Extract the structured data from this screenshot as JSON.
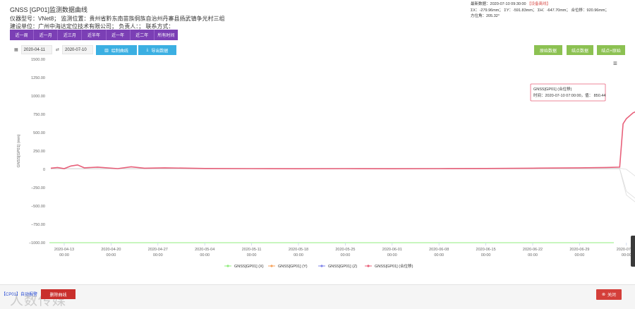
{
  "header": {
    "title": "GNSS [GP01]监测数据曲线",
    "device_line": "仪器型号：VNet8；  监测位置：贵州省黔东南苗族侗族自治州丹寨县扬武镇争光村三组",
    "unit_line": "建设单位：广州中海达定位技术有限公司；  负责人：；  联系方式："
  },
  "latest": {
    "prefix": "最新数据：",
    "time": "2020-07-10 09:30:00",
    "flag": "【设备离线】",
    "xyz": "ΣX：-279.96mm；  ΣY：-591.83mm；  ΣH：-647.70mm；  合位移：920.96mm；",
    "azimuth": "方位角：205.32°"
  },
  "ranges": [
    "近一周",
    "近一月",
    "近三月",
    "近半年",
    "近一年",
    "近二年",
    "所有时间"
  ],
  "dates": {
    "start": "2020-04-11",
    "end": "2020-07-10"
  },
  "toolbar": {
    "draw_label": "绘制曲线",
    "export_label": "导出数据",
    "btn_a": "原始数据",
    "btn_b": "结点数据",
    "btn_c": "结点+原始"
  },
  "icons": {
    "calendar": "calendar-icon",
    "chart": "bar-chart-icon",
    "download": "download-icon",
    "menu": "hamburger-menu-icon",
    "close": "close-circle-icon"
  },
  "chart_data": {
    "type": "line",
    "title": "",
    "ylabel": "GNSS[GP01] (mm)",
    "ylim": [
      -1000,
      1500
    ],
    "yticks": [
      "1500.00",
      "1250.00",
      "1000.00",
      "750.00",
      "500.00",
      "250.00",
      "0",
      "−250.00",
      "−500.00",
      "−750.00",
      "−1000.00"
    ],
    "xticks": [
      {
        "date": "2020-04-13",
        "time": "00:00"
      },
      {
        "date": "2020-04-20",
        "time": "00:00"
      },
      {
        "date": "2020-04-27",
        "time": "00:00"
      },
      {
        "date": "2020-05-04",
        "time": "00:00"
      },
      {
        "date": "2020-05-11",
        "time": "00:00"
      },
      {
        "date": "2020-05-18",
        "time": "00:00"
      },
      {
        "date": "2020-05-25",
        "time": "00:00"
      },
      {
        "date": "2020-06-01",
        "time": "00:00"
      },
      {
        "date": "2020-06-08",
        "time": "00:00"
      },
      {
        "date": "2020-06-15",
        "time": "00:00"
      },
      {
        "date": "2020-06-22",
        "time": "00:00"
      },
      {
        "date": "2020-06-29",
        "time": "00:00"
      },
      {
        "date": "2020-07-06",
        "time": "00:00"
      },
      {
        "date": "2020-07",
        "time": "00:00"
      }
    ],
    "xrange": [
      "2020-04-11",
      "2020-07-10"
    ],
    "series": [
      {
        "name": "GNSS[GP01] (X)",
        "color": "#90ed7d",
        "points": [
          [
            "2020-04-11",
            10
          ],
          [
            "2020-07-05",
            15
          ],
          [
            "2020-07-06",
            0
          ],
          [
            "2020-07-10",
            -280
          ]
        ]
      },
      {
        "name": "GNSS[GP01] (Y)",
        "color": "#f7a35c",
        "points": [
          [
            "2020-04-11",
            8
          ],
          [
            "2020-07-05",
            10
          ],
          [
            "2020-07-06",
            -300
          ],
          [
            "2020-07-10",
            -590
          ]
        ]
      },
      {
        "name": "GNSS[GP01] (Z)",
        "color": "#8085e9",
        "points": [
          [
            "2020-04-11",
            5
          ],
          [
            "2020-07-05",
            5
          ],
          [
            "2020-07-06",
            -350
          ],
          [
            "2020-07-10",
            -640
          ]
        ]
      },
      {
        "name": "GNSS[GP01] (合位移)",
        "color": "#e8607a",
        "points": [
          [
            "2020-04-11",
            15
          ],
          [
            "2020-04-12",
            25
          ],
          [
            "2020-04-13",
            10
          ],
          [
            "2020-04-14",
            45
          ],
          [
            "2020-04-15",
            60
          ],
          [
            "2020-04-16",
            20
          ],
          [
            "2020-04-18",
            30
          ],
          [
            "2020-04-21",
            10
          ],
          [
            "2020-04-23",
            35
          ],
          [
            "2020-04-25",
            15
          ],
          [
            "2020-04-28",
            20
          ],
          [
            "2020-05-04",
            12
          ],
          [
            "2020-05-11",
            10
          ],
          [
            "2020-05-18",
            8
          ],
          [
            "2020-05-25",
            10
          ],
          [
            "2020-06-01",
            8
          ],
          [
            "2020-06-08",
            10
          ],
          [
            "2020-06-15",
            12
          ],
          [
            "2020-06-22",
            15
          ],
          [
            "2020-06-29",
            20
          ],
          [
            "2020-07-03",
            25
          ],
          [
            "2020-07-05",
            30
          ],
          [
            "2020-07-05T12:00",
            620
          ],
          [
            "2020-07-06",
            690
          ],
          [
            "2020-07-07",
            770
          ],
          [
            "2020-07-08",
            810
          ],
          [
            "2020-07-09",
            830
          ],
          [
            "2020-07-10",
            850.44
          ]
        ]
      }
    ],
    "tooltip": {
      "series": "GNSS[GP01] (合位移)",
      "time_label": "时间：",
      "time": "2020-07-10 07:00:00",
      "value_label": "值：",
      "value": "850.44"
    },
    "grid": false,
    "legend": "bottom"
  },
  "footer": {
    "link": "【CP01】自动报警",
    "red_btn": "删除曲线",
    "watermark": "人数传媒",
    "close_label": "关闭"
  }
}
